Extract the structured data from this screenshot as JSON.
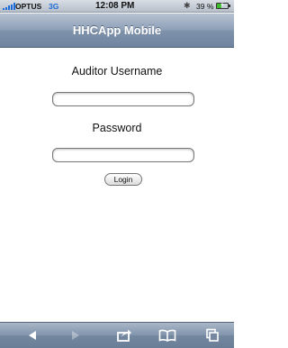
{
  "statusbar": {
    "carrier": "OPTUS",
    "network": "3G",
    "time": "12:08 PM",
    "bluetooth_icon": "bluetooth-icon",
    "battery_percent": "39 %",
    "battery_level": 0.39
  },
  "header": {
    "title": "HHCApp Mobile"
  },
  "form": {
    "username_label": "Auditor Username",
    "username_value": "",
    "password_label": "Password",
    "password_value": "",
    "login_label": "Login"
  },
  "toolbar": {
    "items": [
      "back-arrow-icon",
      "forward-arrow-icon",
      "share-icon",
      "bookmarks-icon",
      "pages-icon"
    ]
  }
}
